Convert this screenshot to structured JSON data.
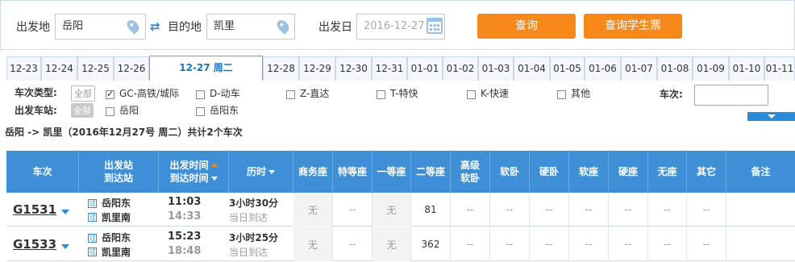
{
  "search": {
    "from_label": "出发地",
    "from_value": "岳阳",
    "to_label": "目的地",
    "to_value": "凯里",
    "date_label": "出发日",
    "date_value": "2016-12-27",
    "query_button": "查询",
    "student_button": "查询学生票"
  },
  "dates": [
    "12-23",
    "12-24",
    "12-25",
    "12-26",
    "12-27 周二",
    "12-28",
    "12-29",
    "12-30",
    "12-31",
    "01-01",
    "01-02",
    "01-03",
    "01-04",
    "01-05",
    "01-06",
    "01-07",
    "01-08",
    "01-09",
    "01-10",
    "01-11"
  ],
  "active_date": "12-27 周二",
  "filters": {
    "type_label": "车次类型:",
    "type_all": "全部",
    "types": [
      "GC-高铁/城际",
      "D-动车",
      "Z-直达",
      "T-特快",
      "K-快速",
      "其他"
    ],
    "station_label": "出发车站:",
    "station_all": "全部",
    "stations": [
      "岳阳",
      "岳阳东"
    ],
    "train_no_label": "车次:"
  },
  "summary": {
    "route": "岳阳 -> 凯里（2016年12月27号  周二）共计",
    "count": "2",
    "suffix": "个车次"
  },
  "table": {
    "headers": {
      "train": "车次",
      "stations_1": "出发站",
      "stations_2": "到达站",
      "times_1": "出发时间",
      "times_2": "到达时间",
      "duration": "历时",
      "business": "商务座",
      "special": "特等座",
      "first": "一等座",
      "second": "二等座",
      "soft_sleeper_hi_1": "高级",
      "soft_sleeper_hi_2": "软卧",
      "soft_sleeper": "软卧",
      "hard_sleeper": "硬卧",
      "soft_seat": "软座",
      "hard_seat": "硬座",
      "no_seat": "无座",
      "other": "其它",
      "remark": "备注"
    },
    "station_tag": "过",
    "rows": [
      {
        "train": "G1531",
        "from": "岳阳东",
        "to": "凯里南",
        "depart": "11:03",
        "arrive": "14:33",
        "duration": "3小时30分",
        "arrive_note": "当日到达",
        "seats": [
          "无",
          "--",
          "无",
          "81",
          "--",
          "--",
          "--",
          "--",
          "--",
          "--",
          "--"
        ]
      },
      {
        "train": "G1533",
        "from": "岳阳东",
        "to": "凯里南",
        "depart": "15:23",
        "arrive": "18:48",
        "duration": "3小时25分",
        "arrive_note": "当日到达",
        "seats": [
          "无",
          "--",
          "无",
          "362",
          "--",
          "--",
          "--",
          "--",
          "--",
          "--",
          "--"
        ]
      }
    ]
  },
  "colors": {
    "accent": "#f7891a",
    "header_blue": "#3f8fd6",
    "link_blue": "#2a8bd8"
  }
}
